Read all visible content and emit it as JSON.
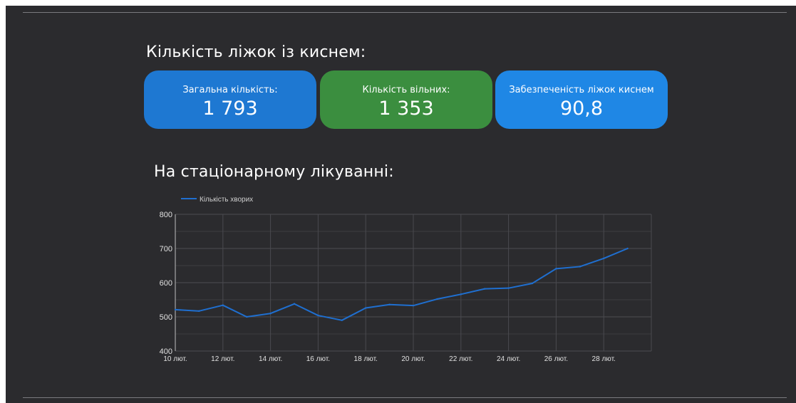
{
  "oxygen_beds": {
    "title": "Кількість ліжок із киснем:",
    "cards": [
      {
        "label": "Загальна кількість:",
        "value": "1 793",
        "color": "#1e78d2"
      },
      {
        "label": "Кількість вільних:",
        "value": "1 353",
        "color": "#3b8e3f"
      },
      {
        "label": "Забезпеченість ліжок киснем",
        "value": "90,8",
        "color": "#1f87e5"
      }
    ]
  },
  "inpatient": {
    "title": "На стаціонарному лікуванні:"
  },
  "chart_data": {
    "type": "line",
    "legend_position": "top-left",
    "grid": true,
    "x": [
      "10 лют.",
      "11 лют.",
      "12 лют.",
      "13 лют.",
      "14 лют.",
      "15 лют.",
      "16 лют.",
      "17 лют.",
      "18 лют.",
      "19 лют.",
      "20 лют.",
      "21 лют.",
      "22 лют.",
      "23 лют.",
      "24 лют.",
      "25 лют.",
      "26 лют.",
      "27 лют.",
      "28 лют.",
      "29 лют."
    ],
    "x_tick_labels": [
      "10 лют.",
      "12 лют.",
      "14 лют.",
      "16 лют.",
      "18 лют.",
      "20 лют.",
      "22 лют.",
      "24 лют.",
      "26 лют.",
      "28 лют."
    ],
    "series": [
      {
        "name": "Кількість хворих",
        "color": "#1f6fd0",
        "values": [
          521,
          517,
          534,
          500,
          510,
          538,
          504,
          490,
          526,
          536,
          533,
          552,
          566,
          582,
          584,
          598,
          641,
          647,
          671,
          700
        ]
      }
    ],
    "ylim": [
      400,
      800
    ],
    "yticks": [
      400,
      500,
      600,
      700,
      800
    ],
    "xlabel": "",
    "ylabel": ""
  }
}
